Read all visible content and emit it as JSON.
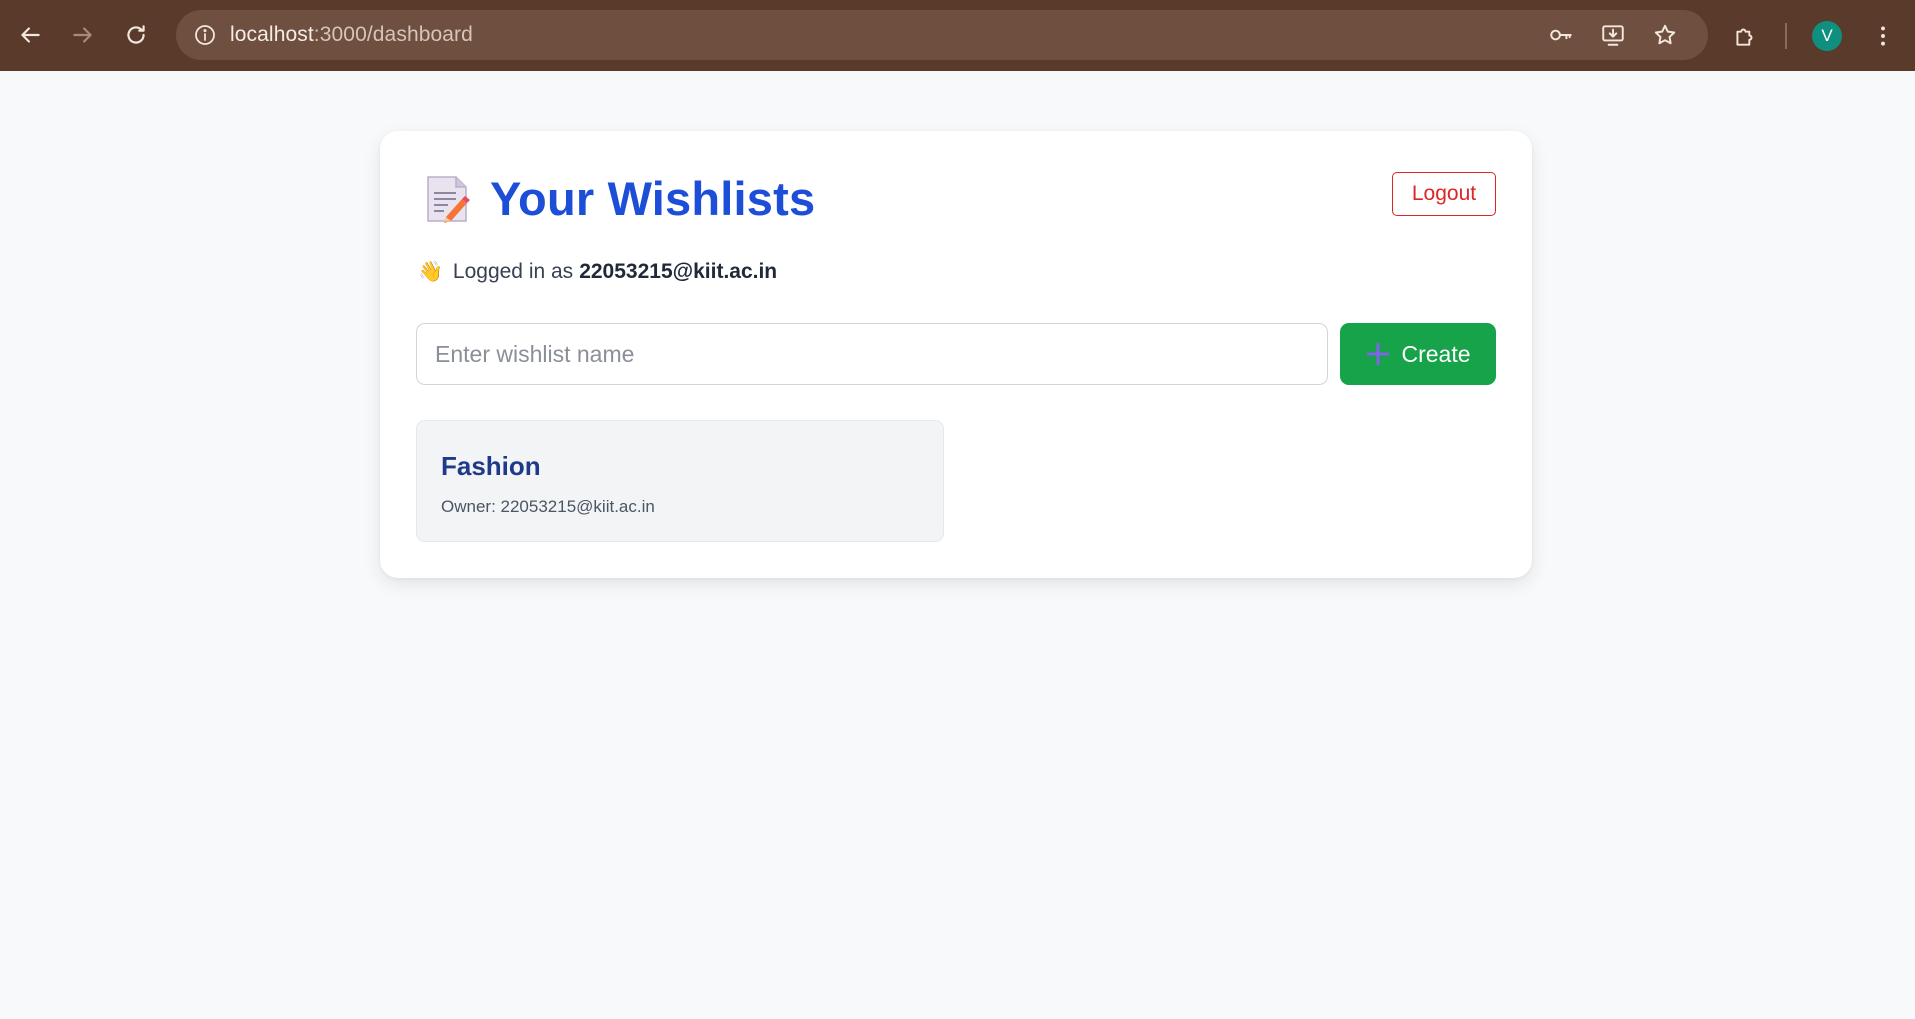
{
  "browser": {
    "url_host": "localhost",
    "url_path": ":3000/dashboard",
    "profile_initial": "V"
  },
  "page": {
    "title": "Your Wishlists",
    "logout_label": "Logout",
    "logged_in_prefix": "Logged in as",
    "user_email": "22053215@kiit.ac.in",
    "wave_emoji": "👋",
    "title_icon": "memo-icon"
  },
  "create_form": {
    "placeholder": "Enter wishlist name",
    "value": "",
    "button_label": "Create"
  },
  "wishlists": [
    {
      "name": "Fashion",
      "owner_label": "Owner: 22053215@kiit.ac.in"
    }
  ],
  "colors": {
    "title": "#1d4ed8",
    "logout": "#dc2626",
    "create": "#16a34a",
    "wishlist_name": "#1e3a8a"
  }
}
